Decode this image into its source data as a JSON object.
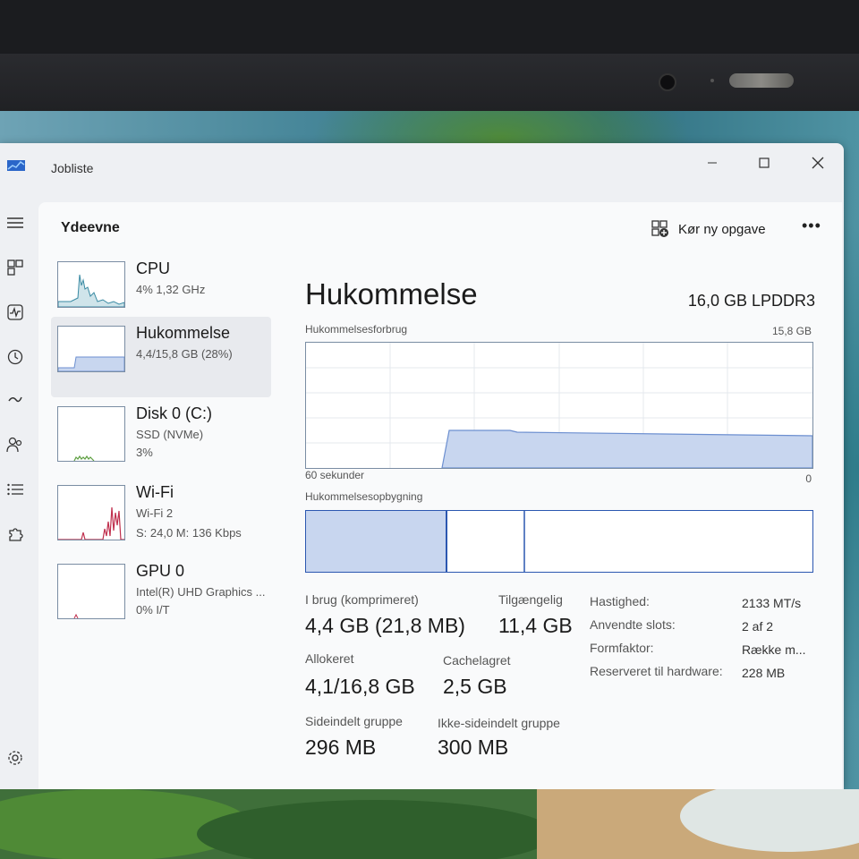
{
  "window": {
    "title": "Jobliste",
    "page_title": "Ydeevne",
    "run_task_label": "Kør ny opgave",
    "more_label": "•••"
  },
  "sidebar": {
    "items": [
      {
        "name": "CPU",
        "line1": "4%  1,32 GHz",
        "line2": ""
      },
      {
        "name": "Hukommelse",
        "line1": "4,4/15,8 GB (28%)",
        "line2": ""
      },
      {
        "name": "Disk 0 (C:)",
        "line1": "SSD (NVMe)",
        "line2": "3%"
      },
      {
        "name": "Wi-Fi",
        "line1": "Wi-Fi 2",
        "line2": "S: 24,0  M: 136 Kbps"
      },
      {
        "name": "GPU 0",
        "line1": "Intel(R) UHD Graphics ...",
        "line2": "0%  I/T"
      }
    ],
    "selected": "Hukommelse"
  },
  "memory": {
    "title": "Hukommelse",
    "spec": "16,0 GB LPDDR3",
    "usage_graph_label": "Hukommelsesforbrug",
    "usage_graph_max": "15,8 GB",
    "usage_graph_time": "60 sekunder",
    "usage_graph_min": "0",
    "composition_label": "Hukommelsesopbygning",
    "stats": {
      "in_use_label": "I brug (komprimeret)",
      "in_use_value": "4,4 GB (21,8 MB)",
      "available_label": "Tilgængelig",
      "available_value": "11,4 GB",
      "committed_label": "Allokeret",
      "committed_value": "4,1/16,8 GB",
      "cached_label": "Cachelagret",
      "cached_value": "2,5 GB",
      "paged_label": "Sideindelt gruppe",
      "paged_value": "296 MB",
      "nonpaged_label": "Ikke-sideindelt gruppe",
      "nonpaged_value": "300 MB"
    },
    "details": [
      {
        "label": "Hastighed:",
        "value": "2133 MT/s"
      },
      {
        "label": "Anvendte slots:",
        "value": "2 af 2"
      },
      {
        "label": "Formfaktor:",
        "value": "Række m..."
      },
      {
        "label": "Reserveret til hardware:",
        "value": "228 MB"
      }
    ]
  },
  "colors": {
    "accent": "#2b57b0",
    "memory_fill": "#c8d6ef",
    "memory_line": "#6c8fd0",
    "cpu_line": "#3a8aa3",
    "disk_line": "#5fa043",
    "wifi_line": "#c0304e"
  }
}
